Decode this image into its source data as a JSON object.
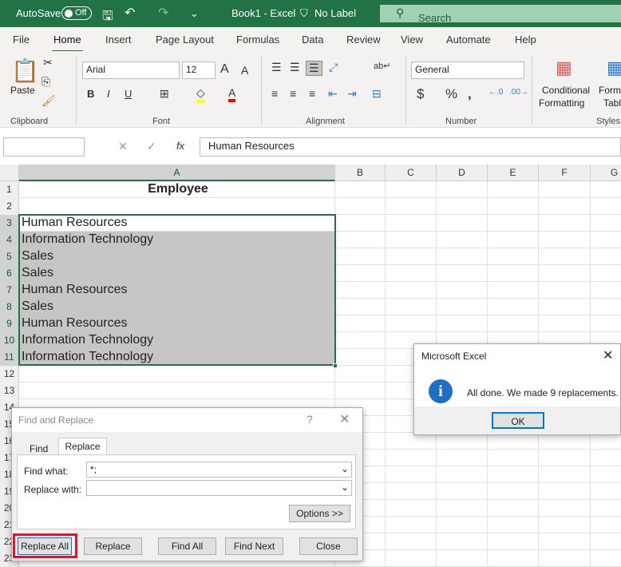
{
  "titlebar": {
    "autosave": "AutoSave",
    "toggle": "Off",
    "title": "Book1  -  Excel",
    "label": "No Label",
    "search": "Search"
  },
  "tabs": [
    "File",
    "Home",
    "Insert",
    "Page Layout",
    "Formulas",
    "Data",
    "Review",
    "View",
    "Automate",
    "Help"
  ],
  "ribbon": {
    "paste": "Paste",
    "clipboard": "Clipboard",
    "font_name": "Arial",
    "font_size": "12",
    "font": "Font",
    "alignment": "Alignment",
    "number_format": "General",
    "number": "Number",
    "conditional": "Conditional",
    "formatting": "Formatting",
    "format_as": "Form",
    "table": "Tabl",
    "styles": "Styles",
    "highlight_color": "#ffff00",
    "font_color": "#ff0000"
  },
  "formula_bar": {
    "name_box": "",
    "value": "Human Resources",
    "fx": "fx"
  },
  "columns": [
    "A",
    "B",
    "C",
    "D",
    "E",
    "F",
    "G"
  ],
  "rows": [
    {
      "n": "1",
      "a": "Employee"
    },
    {
      "n": "2",
      "a": ""
    },
    {
      "n": "3",
      "a": "Human Resources"
    },
    {
      "n": "4",
      "a": "Information Technology"
    },
    {
      "n": "5",
      "a": "Sales"
    },
    {
      "n": "6",
      "a": "Sales"
    },
    {
      "n": "7",
      "a": "Human Resources"
    },
    {
      "n": "8",
      "a": "Sales"
    },
    {
      "n": "9",
      "a": "Human Resources"
    },
    {
      "n": "10",
      "a": "Information Technology"
    },
    {
      "n": "11",
      "a": "Information Technology"
    },
    {
      "n": "12",
      "a": ""
    },
    {
      "n": "13",
      "a": ""
    },
    {
      "n": "14",
      "a": ""
    },
    {
      "n": "15",
      "a": ""
    },
    {
      "n": "16",
      "a": ""
    },
    {
      "n": "17",
      "a": ""
    },
    {
      "n": "18",
      "a": ""
    },
    {
      "n": "19",
      "a": ""
    },
    {
      "n": "20",
      "a": ""
    },
    {
      "n": "21",
      "a": ""
    },
    {
      "n": "22",
      "a": ""
    },
    {
      "n": "23",
      "a": ""
    }
  ],
  "find_dialog": {
    "title": "Find and Replace",
    "help": "?",
    "tab_find": "Find",
    "tab_replace": "Replace",
    "find_label": "Find what:",
    "find_value": "*;",
    "replace_label": "Replace with:",
    "replace_value": "",
    "options": "Options >>",
    "replace_all": "Replace All",
    "replace": "Replace",
    "find_all": "Find All",
    "find_next": "Find Next",
    "close": "Close"
  },
  "msgbox": {
    "title": "Microsoft Excel",
    "message": "All done. We made 9 replacements.",
    "ok": "OK"
  }
}
